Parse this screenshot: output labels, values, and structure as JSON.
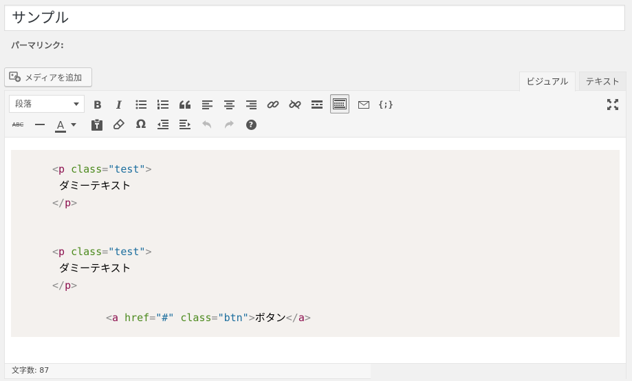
{
  "post": {
    "title": "サンプル",
    "permalink_label": "パーマリンク:"
  },
  "media": {
    "add_label": "メディアを追加"
  },
  "tabs": [
    {
      "label": "ビジュアル",
      "active": true
    },
    {
      "label": "テキスト",
      "active": false
    }
  ],
  "toolbar": {
    "format_select": "段落",
    "row1_icons": [
      "bold-icon",
      "italic-icon",
      "bulleted-list-icon",
      "numbered-list-icon",
      "blockquote-icon",
      "align-left-icon",
      "align-center-icon",
      "align-right-icon",
      "link-icon",
      "unlink-icon",
      "read-more-icon",
      "toolbar-toggle-icon",
      "mail-icon",
      "code-braces-icon",
      "fullscreen-icon"
    ],
    "row2_icons": [
      "strikethrough-icon",
      "horizontal-line-icon",
      "text-color-icon",
      "paste-text-icon",
      "clear-formatting-icon",
      "special-character-icon",
      "outdent-icon",
      "indent-icon",
      "undo-icon",
      "redo-icon",
      "help-icon"
    ],
    "bold": "B",
    "italic": "I",
    "strikethrough": "ABC",
    "text_color": "A",
    "special_char": "Ω",
    "code_braces": "{;}",
    "help": "?"
  },
  "content": {
    "block1": {
      "open_tag": "p",
      "attr_name": "class",
      "attr_value": "\"test\"",
      "text": "ダミーテキスト",
      "close_tag": "p"
    },
    "block2": {
      "open_tag": "p",
      "attr_name": "class",
      "attr_value": "\"test\"",
      "text": "ダミーテキスト",
      "close_tag": "p"
    },
    "link": {
      "tag": "a",
      "href_name": "href",
      "href_value": "\"#\"",
      "class_name": "class",
      "class_value": "\"btn\"",
      "text": "ボタン"
    },
    "syntax": {
      "lt": "<",
      "gt": ">",
      "lt_slash": "</",
      "eq": "="
    }
  },
  "status": {
    "word_count": "文字数: 87"
  },
  "colors": {
    "tag": "#8b0f4e",
    "attribute": "#4c8a1e",
    "value": "#1c6e9e",
    "bracket": "#8a8a8a",
    "code_bg": "#f4f1ee"
  }
}
